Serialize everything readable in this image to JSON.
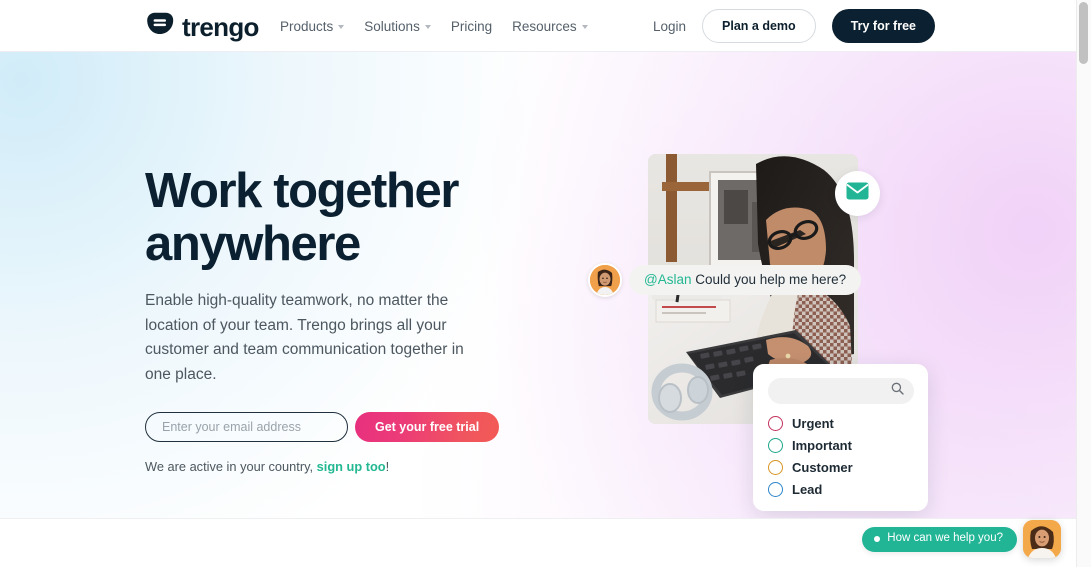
{
  "brand": {
    "name": "trengo",
    "logo_icon": "trengo-leaf-logo-icon",
    "accent_teal": "#23b892",
    "dark": "#0b2030",
    "cta_gradient_start": "#e8307f",
    "cta_gradient_end": "#f25a55"
  },
  "nav": {
    "links": [
      {
        "label": "Products",
        "has_caret": true
      },
      {
        "label": "Solutions",
        "has_caret": true
      },
      {
        "label": "Pricing",
        "has_caret": false
      },
      {
        "label": "Resources",
        "has_caret": true
      }
    ],
    "login_label": "Login",
    "demo_label": "Plan a demo",
    "try_label": "Try for free"
  },
  "hero": {
    "title_line1": "Work together",
    "title_line2": "anywhere",
    "subtitle": "Enable high-quality teamwork, no matter the location of your team. Trengo brings all your customer and team communication together in one place.",
    "email_placeholder": "Enter your email address",
    "email_value": "",
    "trial_button": "Get your free trial",
    "active_prefix": "We are active in your country, ",
    "active_link": "sign up too",
    "active_suffix": "!"
  },
  "visual": {
    "mail_icon": "envelope-icon",
    "chat": {
      "avatar_icon": "user-avatar",
      "mention": "@Aslan",
      "message": " Could you help me here?"
    },
    "labels_card": {
      "search_placeholder": "",
      "search_icon": "search-icon",
      "items": [
        {
          "name": "Urgent",
          "color": "#c2325c"
        },
        {
          "name": "Important",
          "color": "#1ea68b"
        },
        {
          "name": "Customer",
          "color": "#d99423"
        },
        {
          "name": "Lead",
          "color": "#2e86c8"
        }
      ]
    }
  },
  "chat_widget": {
    "prompt": "How can we help you?",
    "status_dot": "online-status-dot",
    "launcher_icon": "support-agent-avatar",
    "pill_color": "#21b596"
  }
}
